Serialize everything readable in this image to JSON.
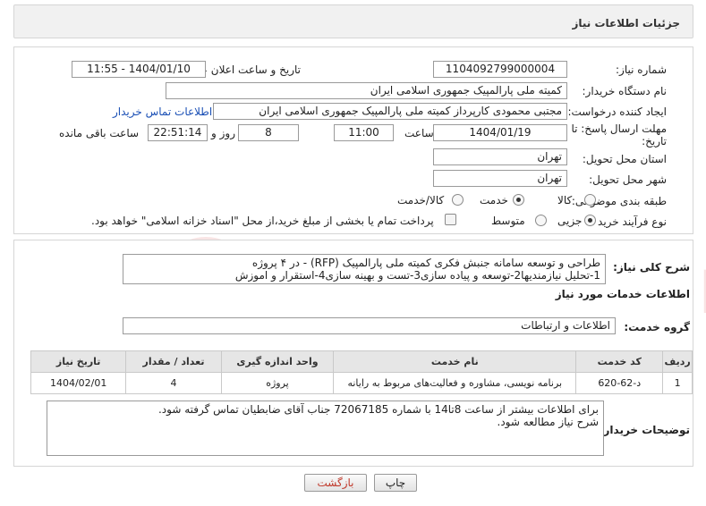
{
  "header": {
    "title": "جزئیات اطلاعات نیاز"
  },
  "form": {
    "need_number_label": "شماره نیاز:",
    "need_number": "1104092799000004",
    "announce_datetime_label": "تاریخ و ساعت اعلان عمومی:",
    "announce_datetime": "1404/01/10 - 11:55",
    "buyer_org_label": "نام دستگاه خریدار:",
    "buyer_org": "کمیته ملی پارالمپیک جمهوری اسلامی ایران",
    "requester_label": "ایجاد کننده درخواست:",
    "requester": "مجتبی محمودی کارپرداز کمیته ملی پارالمپیک جمهوری اسلامی ایران",
    "buyer_contact_link": "اطلاعات تماس خریدار",
    "deadline_label_line1": "مهلت ارسال پاسخ: تا",
    "deadline_label_line2": "تاریخ:",
    "deadline_date": "1404/01/19",
    "time_label": "ساعت",
    "deadline_time": "11:00",
    "days_value": "8",
    "days_label": "روز و",
    "remaining_time": "22:51:14",
    "remaining_label": "ساعت باقی مانده",
    "province_label": "استان محل تحویل:",
    "province": "تهران",
    "city_label": "شهر محل تحویل:",
    "city": "تهران",
    "category_label": "طبقه بندی موضوعی:",
    "category_options": [
      "کالا",
      "خدمت",
      "کالا/خدمت"
    ],
    "category_selected": "خدمت",
    "process_label": "نوع فرآیند خرید :",
    "process_options": [
      "جزیی",
      "متوسط"
    ],
    "process_selected": "جزیی",
    "payment_note": "پرداخت تمام یا بخشی از مبلغ خرید،از محل \"اسناد خزانه اسلامی\" خواهد بود."
  },
  "description": {
    "summary_label": "شرح کلی نیاز:",
    "summary_line1": "طراحی و توسعه سامانه جنبش فکری کمیته ملی پارالمپیک (RFP) - در ۴ پروژه",
    "summary_line2": "1-تحلیل نیازمندیها2-توسعه و پیاده سازی3-تست و بهینه سازی4-استقرار و اموزش",
    "services_heading": "اطلاعات خدمات مورد نیاز",
    "service_group_label": "گروه خدمت:",
    "service_group": "اطلاعات و ارتباطات",
    "table": {
      "headers": [
        "ردیف",
        "کد خدمت",
        "نام خدمت",
        "واحد اندازه گیری",
        "تعداد / مقدار",
        "تاریخ نیاز"
      ],
      "rows": [
        [
          "1",
          "د-62-620",
          "برنامه نویسی، مشاوره و فعالیت‌های مربوط به رایانه",
          "پروژه",
          "4",
          "1404/02/01"
        ]
      ]
    },
    "buyer_notes_label": "توضیحات خریدار:",
    "buyer_notes_line1": "برای اطلاعات بیشتر از ساعت 8تا14 با شماره 72067185 جناب آقای ضابطیان تماس گرفته شود.",
    "buyer_notes_line2": "شرح نیاز مطالعه شود."
  },
  "buttons": {
    "print": "چاپ",
    "back": "بازگشت"
  },
  "colors": {
    "link": "#1a4fb5",
    "back_text": "#c0392b",
    "watermark": "#d13b3b"
  }
}
